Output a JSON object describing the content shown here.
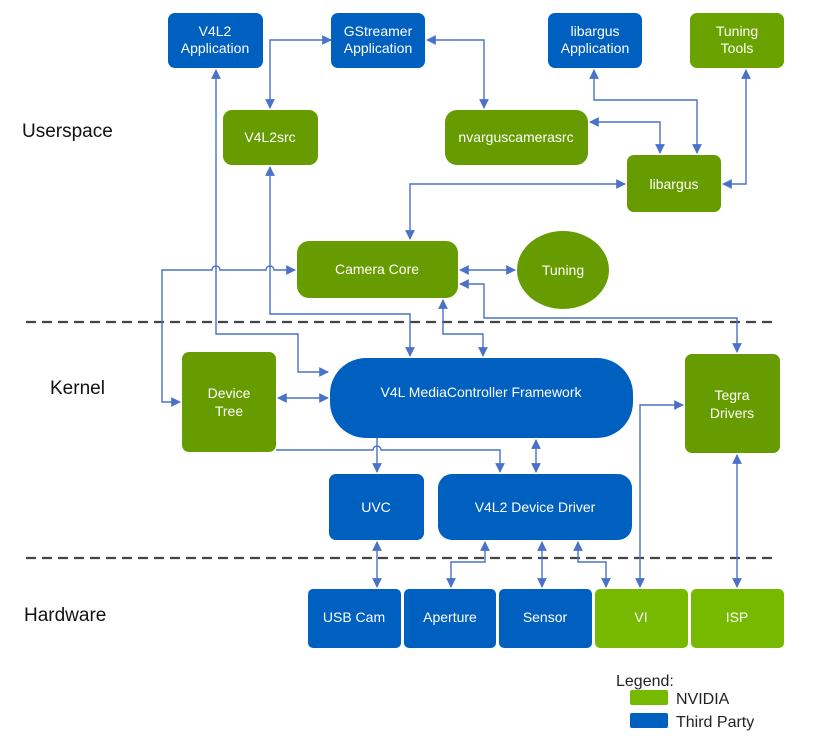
{
  "colors": {
    "third_party": "#0060c0",
    "nvidia_dark": "#669c00",
    "nvidia_light": "#76b900",
    "connector": "#4a72c8"
  },
  "layers": {
    "userspace": "Userspace",
    "kernel": "Kernel",
    "hardware": "Hardware"
  },
  "nodes": {
    "v4l2_app": [
      "V4L2",
      "Application"
    ],
    "gstreamer_app": [
      "GStreamer",
      "Application"
    ],
    "libargus_app": [
      "libargus",
      "Application"
    ],
    "tuning_tools": [
      "Tuning",
      "Tools"
    ],
    "v4l2src": "V4L2src",
    "nvarguscamerasrc": "nvarguscamerasrc",
    "libargus": "libargus",
    "camera_core": "Camera Core",
    "tuning": "Tuning",
    "device_tree": [
      "Device",
      "Tree"
    ],
    "mediacontroller": "V4L MediaController Framework",
    "tegra_drivers": [
      "Tegra",
      "Drivers"
    ],
    "uvc": "UVC",
    "v4l2_device_driver": "V4L2 Device Driver",
    "usb_cam": "USB Cam",
    "aperture": "Aperture",
    "sensor": "Sensor",
    "vi": "VI",
    "isp": "ISP"
  },
  "legend": {
    "title": "Legend:",
    "items": [
      {
        "label": "NVIDIA"
      },
      {
        "label": "Third Party"
      }
    ]
  }
}
